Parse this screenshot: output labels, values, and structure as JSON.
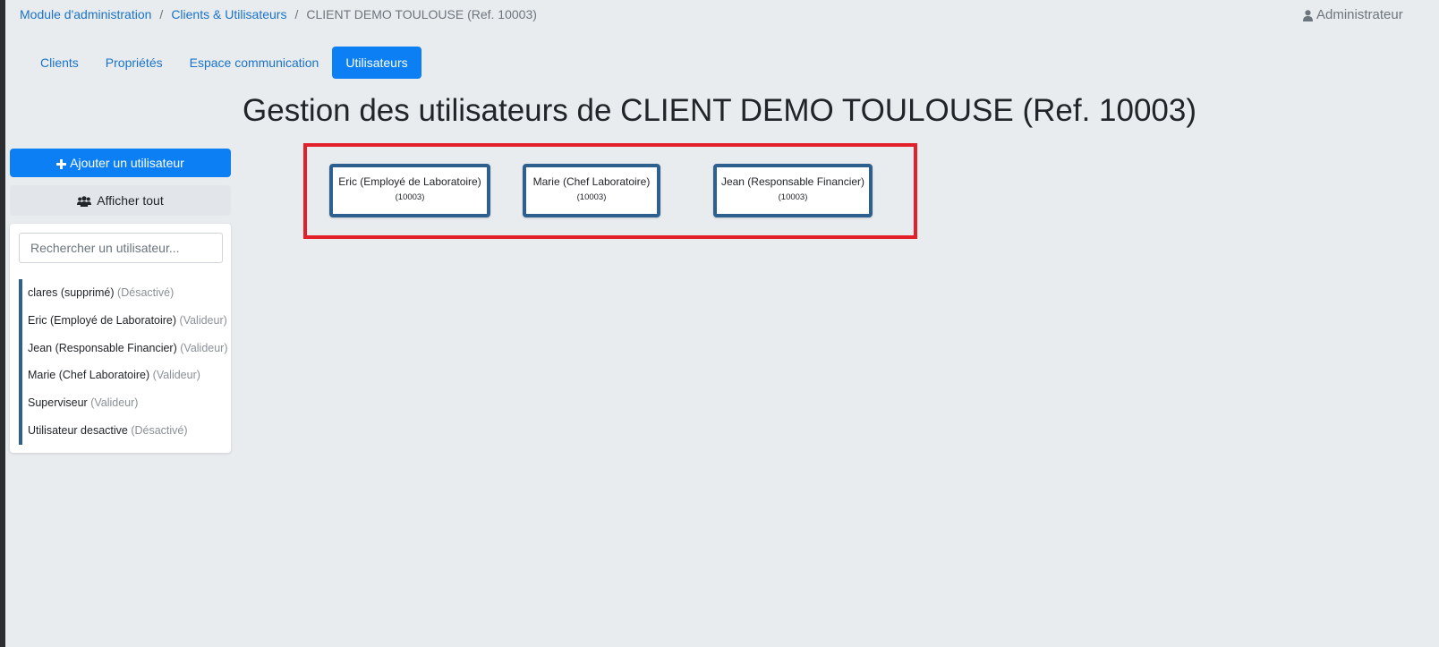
{
  "breadcrumb": {
    "items": [
      "Module d'administration",
      "Clients & Utilisateurs"
    ],
    "separator": "/",
    "current": "CLIENT DEMO TOULOUSE (Ref. 10003)"
  },
  "user_menu": {
    "label": "Administrateur",
    "icon": "user-icon"
  },
  "tabs": [
    {
      "label": "Clients"
    },
    {
      "label": "Propriétés"
    },
    {
      "label": "Espace communication"
    },
    {
      "label": "Utilisateurs",
      "active": true
    }
  ],
  "page_title": "Gestion des utilisateurs de CLIENT DEMO TOULOUSE (Ref. 10003)",
  "sidebar": {
    "add_button": {
      "label": "Ajouter un utilisateur",
      "icon": "plus-icon"
    },
    "show_all_button": {
      "label": "Afficher tout",
      "icon": "users-icon"
    },
    "search": {
      "placeholder": "Rechercher un utilisateur..."
    },
    "users": [
      {
        "name": "clares (supprimé)",
        "status": "(Désactivé)"
      },
      {
        "name": "Eric (Employé de Laboratoire)",
        "status": "(Valideur)"
      },
      {
        "name": "Jean (Responsable Financier)",
        "status": "(Valideur)"
      },
      {
        "name": "Marie (Chef Laboratoire)",
        "status": "(Valideur)"
      },
      {
        "name": "Superviseur",
        "status": "(Valideur)"
      },
      {
        "name": "Utilisateur desactive",
        "status": "(Désactivé)"
      }
    ]
  },
  "org_chart": {
    "cards": [
      {
        "name": "Eric (Employé de Laboratoire)",
        "ref": "(10003)"
      },
      {
        "name": "Marie (Chef Laboratoire)",
        "ref": "(10003)"
      },
      {
        "name": "Jean (Responsable Financier)",
        "ref": "(10003)"
      }
    ]
  },
  "colors": {
    "primary": "#0d7ff5",
    "link": "#1a73c8",
    "card_border": "#2d5f8f",
    "highlight_frame": "#e3202a",
    "background": "#e9ecef"
  }
}
